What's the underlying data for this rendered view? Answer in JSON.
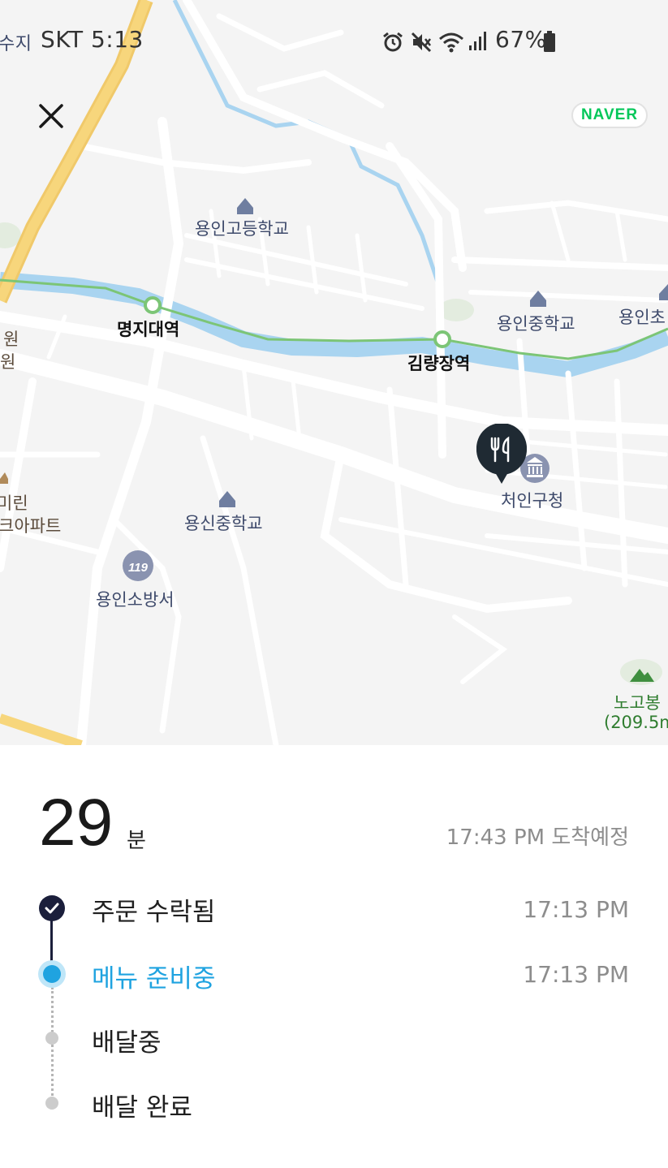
{
  "status_bar": {
    "prev_place": "수지",
    "carrier_time": "SKT 5:13",
    "battery": "67%"
  },
  "map": {
    "brand": "NAVER",
    "labels": {
      "school_high": "용인고등학교",
      "station_myongji": "명지대역",
      "school_middle": "용인중학교",
      "school_elem": "용인초",
      "station_gimryang": "김량장역",
      "gov": "처인구청",
      "school_yongsin": "용신중학교",
      "fire_station": "용인소방서",
      "left_a": "원",
      "left_b": "원",
      "left_apt_a": "미린",
      "left_apt_b": "크아파트",
      "mountain": "노고봉",
      "mountain_height": "(209.5m"
    }
  },
  "eta": {
    "minutes": "29",
    "unit": "분",
    "arrival": "17:43 PM 도착예정"
  },
  "steps": [
    {
      "label": "주문 수락됨",
      "time": "17:13 PM",
      "state": "done"
    },
    {
      "label": "메뉴 준비중",
      "time": "17:13 PM",
      "state": "active"
    },
    {
      "label": "배달중",
      "time": "",
      "state": "pending"
    },
    {
      "label": "배달 완료",
      "time": "",
      "state": "pending"
    }
  ],
  "colors": {
    "accent": "#1fa3e0",
    "done": "#1b1f3b",
    "pending": "#cccccc",
    "river": "#a9d4f0",
    "rail": "#7cc576",
    "highway": "#f7d67c"
  },
  "icons": [
    "close-icon",
    "alarm-icon",
    "mute-icon",
    "wifi-icon",
    "signal-icon",
    "battery-icon",
    "restaurant-pin-icon",
    "school-icon",
    "government-icon",
    "fire-station-icon",
    "mountain-icon",
    "check-icon"
  ]
}
